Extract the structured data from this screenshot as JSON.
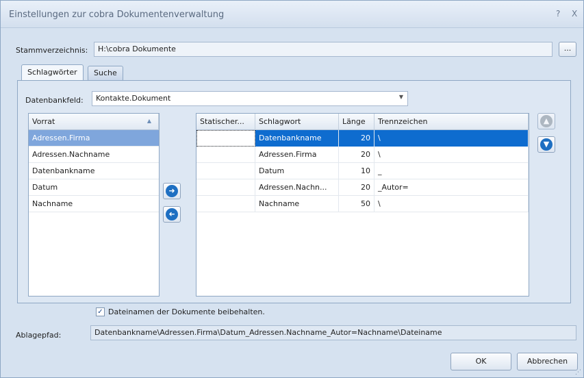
{
  "window": {
    "title": "Einstellungen zur cobra Dokumentenverwaltung",
    "help_glyph": "?",
    "close_glyph": "X"
  },
  "stammverzeichnis": {
    "label": "Stammverzeichnis:",
    "value": "H:\\cobra Dokumente",
    "browse_label": "..."
  },
  "tabs": [
    {
      "label": "Schlagwörter"
    },
    {
      "label": "Suche"
    }
  ],
  "datenbankfeld": {
    "label": "Datenbankfeld:",
    "value": "Kontakte.Dokument"
  },
  "vorrat": {
    "header": "Vorrat",
    "items": [
      "Adressen.Firma",
      "Adressen.Nachname",
      "Datenbankname",
      "Datum",
      "Nachname"
    ]
  },
  "schlagwoerter": {
    "headers": [
      "Statischer...",
      "Schlagwort",
      "Länge",
      "Trennzeichen"
    ],
    "rows": [
      {
        "statisch": "",
        "schlagwort": "Datenbankname",
        "laenge": "20",
        "trenn": "\\"
      },
      {
        "statisch": "",
        "schlagwort": "Adressen.Firma",
        "laenge": "20",
        "trenn": "\\"
      },
      {
        "statisch": "",
        "schlagwort": "Datum",
        "laenge": "10",
        "trenn": "_"
      },
      {
        "statisch": "",
        "schlagwort": "Adressen.Nachn...",
        "laenge": "20",
        "trenn": "_Autor="
      },
      {
        "statisch": "",
        "schlagwort": "Nachname",
        "laenge": "50",
        "trenn": "\\"
      }
    ]
  },
  "checkbox": {
    "label": "Dateinamen der Dokumente beibehalten.",
    "checked_glyph": "✓"
  },
  "ablagepfad": {
    "label": "Ablagepfad:",
    "value": "Datenbankname\\Adressen.Firma\\Datum_Adressen.Nachname_Autor=Nachname\\Dateiname"
  },
  "buttons": {
    "ok": "OK",
    "cancel": "Abbrechen"
  },
  "colors": {
    "selection": "#0e6ccf",
    "accent_circle": "#1e6fc2"
  }
}
